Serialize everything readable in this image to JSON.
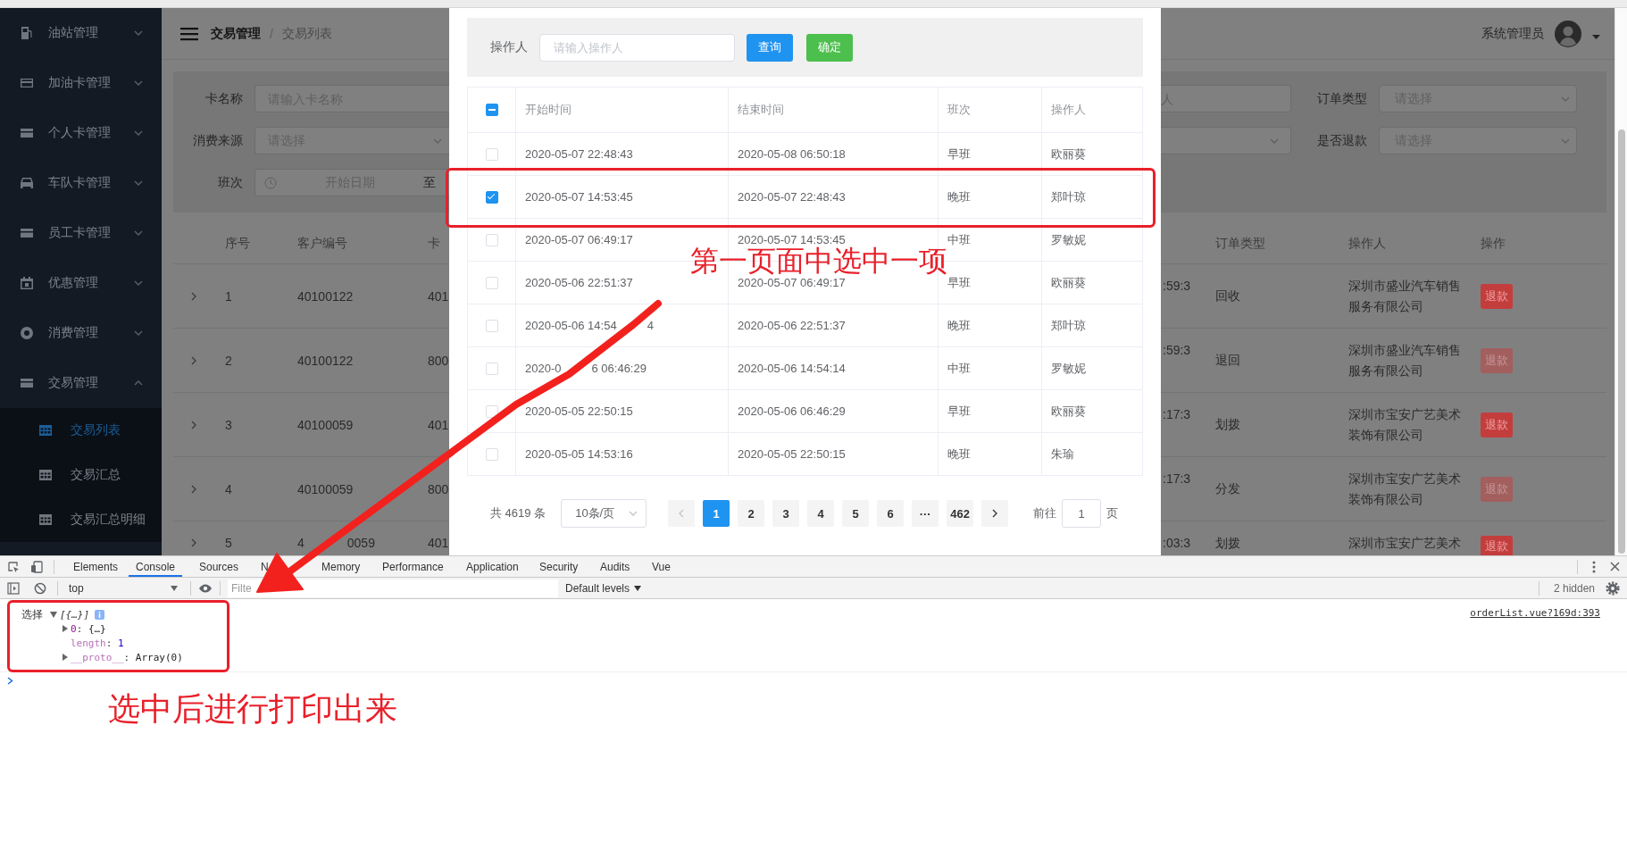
{
  "sidebar": {
    "items": [
      {
        "label": "油站管理",
        "expanded": false
      },
      {
        "label": "加油卡管理",
        "expanded": false
      },
      {
        "label": "个人卡管理",
        "expanded": false
      },
      {
        "label": "车队卡管理",
        "expanded": false
      },
      {
        "label": "员工卡管理",
        "expanded": false
      },
      {
        "label": "优惠管理",
        "expanded": false
      },
      {
        "label": "消费管理",
        "expanded": false
      },
      {
        "label": "交易管理",
        "expanded": true,
        "children": [
          {
            "label": "交易列表",
            "selected": true
          },
          {
            "label": "交易汇总",
            "selected": false
          },
          {
            "label": "交易汇总明细",
            "selected": false
          }
        ]
      }
    ]
  },
  "header": {
    "breadcrumb": [
      {
        "label": "交易管理"
      },
      {
        "label": "交易列表"
      }
    ],
    "breadcrumb_separator": "/",
    "user": "系统管理员"
  },
  "filter_form": {
    "rows": [
      {
        "left": {
          "label": "卡名称",
          "kind": "input",
          "placeholder": "请输入卡名称"
        },
        "right_cut": {
          "kind": "input",
          "placeholder": "人"
        },
        "right": {
          "label": "订单类型",
          "kind": "select",
          "placeholder": "请选择"
        }
      },
      {
        "left": {
          "label": "消费来源",
          "kind": "select",
          "placeholder": "请选择"
        },
        "right_cut": {
          "kind": "select"
        },
        "right": {
          "label": "是否退款",
          "kind": "select",
          "placeholder": "请选择"
        }
      },
      {
        "left": {
          "label": "班次",
          "kind": "daterange",
          "placeholder": "开始日期",
          "separator": "至"
        }
      }
    ]
  },
  "order_table": {
    "columns_left": [
      "序号",
      "客户编号",
      "卡"
    ],
    "columns_right": [
      "订单类型",
      "操作人",
      "操作"
    ],
    "rows": [
      {
        "index": "1",
        "customer_no": "40100122",
        "card_no": "401",
        "time": ":59:3",
        "order_type": "回收",
        "operator": "深圳市盛业汽车销售服务有限公司",
        "action": "退款",
        "action_disabled": false
      },
      {
        "index": "2",
        "customer_no": "40100122",
        "card_no": "800",
        "time": ":59:3",
        "order_type": "退回",
        "operator": "深圳市盛业汽车销售服务有限公司",
        "action": "退款",
        "action_disabled": true
      },
      {
        "index": "3",
        "customer_no": "40100059",
        "card_no": "401",
        "time": ":17:3",
        "order_type": "划拨",
        "operator": "深圳市宝安广艺美术装饰有限公司",
        "action": "退款",
        "action_disabled": false
      },
      {
        "index": "4",
        "customer_no": "40100059",
        "card_no": "800",
        "time": ":17:3",
        "order_type": "分发",
        "operator": "深圳市宝安广艺美术装饰有限公司",
        "action": "退款",
        "action_disabled": true
      },
      {
        "index": "5",
        "customer_no": [
          "4",
          "0059"
        ],
        "card_no": "401",
        "time": ":03:3",
        "order_type": "划拨",
        "operator": "深圳市宝安广艺美术",
        "action": "退款",
        "action_disabled": false
      }
    ]
  },
  "dialog": {
    "search": {
      "label": "操作人",
      "placeholder": "请输入操作人"
    },
    "buttons": [
      {
        "label": "查询",
        "kind": "primary"
      },
      {
        "label": "确定",
        "kind": "success"
      }
    ],
    "table": {
      "select_all": {
        "indeterminate": true
      },
      "columns": [
        "开始时间",
        "结束时间",
        "班次",
        "操作人"
      ],
      "rows": [
        {
          "checked": false,
          "start": "2020-05-07 22:48:43",
          "end": "2020-05-08 06:50:18",
          "shift": "早班",
          "operator": "欧丽葵"
        },
        {
          "checked": true,
          "start": "2020-05-07 14:53:45",
          "end": "2020-05-07 22:48:43",
          "shift": "晚班",
          "operator": "郑叶琼"
        },
        {
          "checked": false,
          "start": "2020-05-07 06:49:17",
          "end": "2020-05-07 14:53:45",
          "shift": "中班",
          "operator": "罗敏妮"
        },
        {
          "checked": false,
          "start": "2020-05-06 22:51:37",
          "end": "2020-05-07 06:49:17",
          "shift": "早班",
          "operator": "欧丽葵"
        },
        {
          "checked": false,
          "start": [
            "2020-05-06 14:54",
            "4"
          ],
          "end": "2020-05-06 22:51:37",
          "shift": "晚班",
          "operator": "郑叶琼"
        },
        {
          "checked": false,
          "start": [
            "2020-0",
            "6 06:46:29"
          ],
          "end": "2020-05-06 14:54:14",
          "shift": "中班",
          "operator": "罗敏妮"
        },
        {
          "checked": false,
          "start": "2020-05-05 22:50:15",
          "end": "2020-05-06 06:46:29",
          "shift": "早班",
          "operator": "欧丽葵"
        },
        {
          "checked": false,
          "start": "2020-05-05 14:53:16",
          "end": "2020-05-05 22:50:15",
          "shift": "晚班",
          "operator": "朱瑜"
        }
      ]
    },
    "pagination": {
      "total": "共 4619 条",
      "page_size": "10条/页",
      "prev_disabled": true,
      "next_disabled": false,
      "pages": [
        {
          "label": "1",
          "selected": true
        },
        {
          "label": "2",
          "selected": false
        },
        {
          "label": "3",
          "selected": false
        },
        {
          "label": "4",
          "selected": false
        },
        {
          "label": "5",
          "selected": false
        },
        {
          "label": "6",
          "selected": false
        },
        {
          "label": "···",
          "selected": false
        },
        {
          "label": "462",
          "selected": false
        }
      ],
      "jump_label": "前往",
      "jump_value": "1",
      "jump_unit": "页"
    }
  },
  "devtools": {
    "tabs": [
      {
        "label": "Elements",
        "selected": false
      },
      {
        "label": "Console",
        "selected": true
      },
      {
        "label": "Sources",
        "selected": false
      },
      {
        "label": "N",
        "selected": false
      },
      {
        "label": "Memory",
        "selected": false
      },
      {
        "label": "Performance",
        "selected": false
      },
      {
        "label": "Application",
        "selected": false
      },
      {
        "label": "Security",
        "selected": false
      },
      {
        "label": "Audits",
        "selected": false
      },
      {
        "label": "Vue",
        "selected": false
      }
    ],
    "context": "top",
    "filter_placeholder": "Filte",
    "levels": "Default levels",
    "hidden": "2 hidden",
    "messages": [
      {
        "label": "选择",
        "preview": "[{…}]",
        "expanded": true,
        "source": "orderList.vue?169d:393",
        "properties": [
          {
            "key": "0",
            "sep": ": ",
            "value": "{…}",
            "kind": "object",
            "expandable": true,
            "enumerable": true
          },
          {
            "key": "length",
            "sep": ": ",
            "value": "1",
            "kind": "number",
            "expandable": false,
            "enumerable": false
          },
          {
            "key": "__proto__",
            "sep": ": ",
            "value": "Array(0)",
            "kind": "object",
            "expandable": true,
            "enumerable": false
          }
        ]
      }
    ]
  },
  "annotations": [
    {
      "text": "第一页面中选中一项"
    },
    {
      "text": "选中后进行打印出来"
    }
  ]
}
